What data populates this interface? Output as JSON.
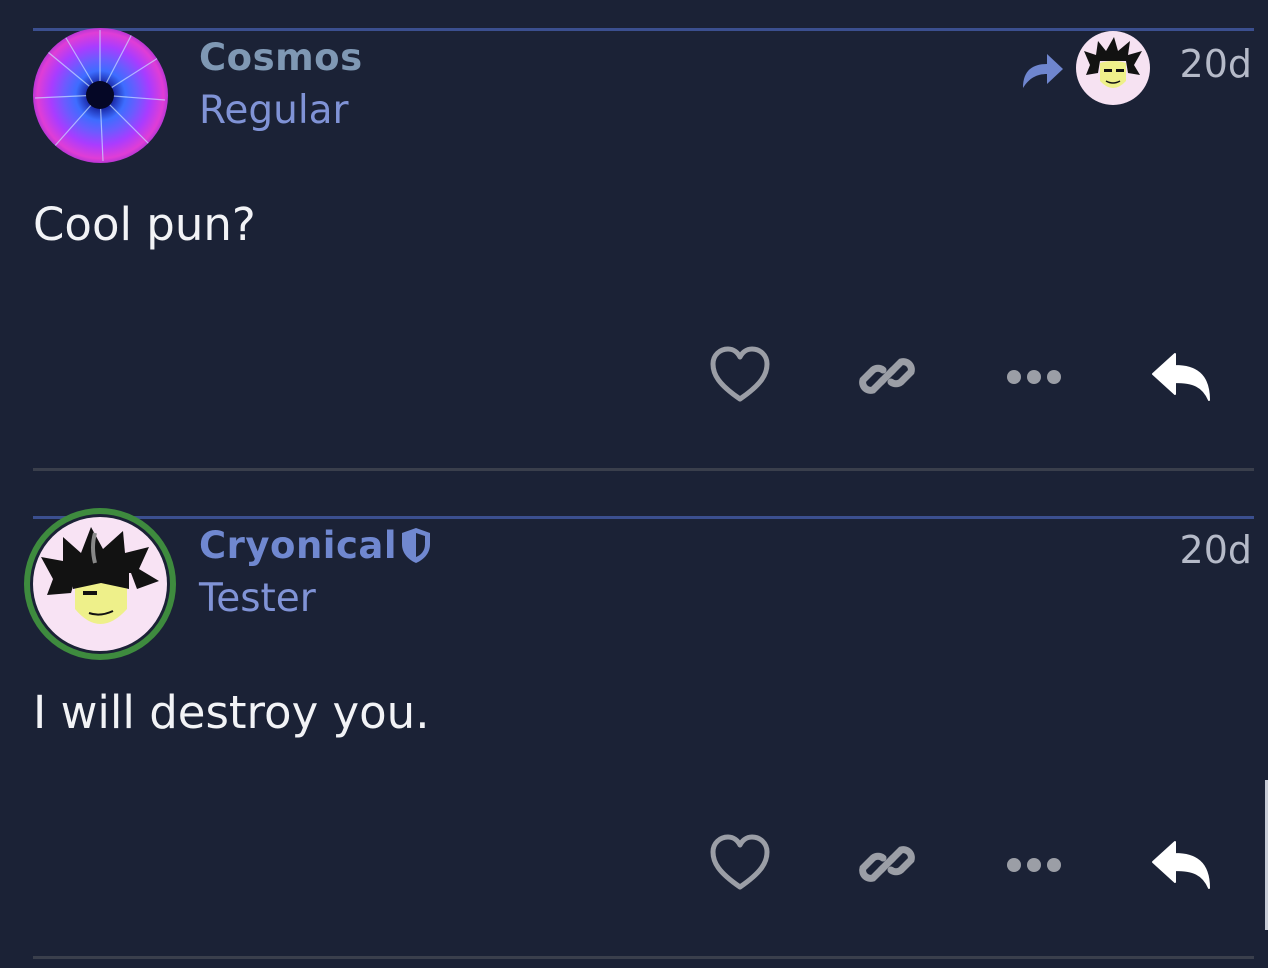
{
  "posts": [
    {
      "username": "Cosmos",
      "user_title": "Regular",
      "date": "20d",
      "content": "Cool pun?",
      "reply_to_indicator": "reply-arrow-icon",
      "username_color": "#7f98b4"
    },
    {
      "username": "Cryonical",
      "user_title": "Tester",
      "date": "20d",
      "content": "I will destroy you.",
      "badge": "shield-icon",
      "username_color": "#7088d0",
      "avatar_ring_color": "#3e8b3e"
    }
  ],
  "actions": {
    "like": "heart-icon",
    "link": "link-icon",
    "more": "ellipsis-icon",
    "reply": "reply-icon"
  },
  "colors": {
    "background": "#1b2236",
    "accent": "#3b4f8f",
    "title": "#8093d6",
    "icon_gray": "#9b9ea6"
  }
}
